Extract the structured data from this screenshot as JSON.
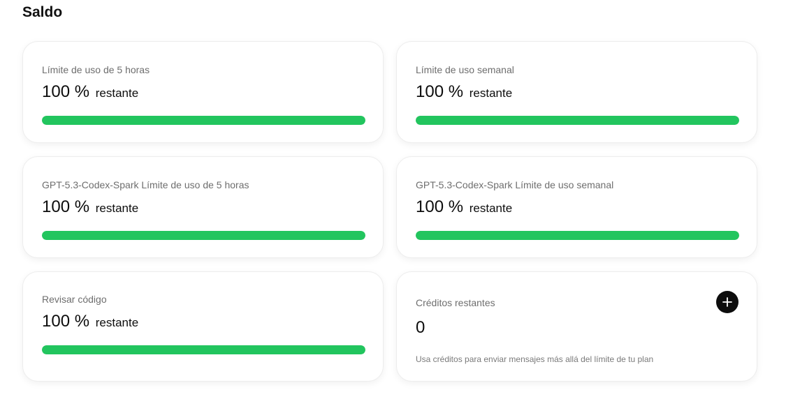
{
  "section": {
    "title": "Saldo"
  },
  "cards": [
    {
      "label": "Límite de uso de 5 horas",
      "value": "100 %",
      "suffix": "restante",
      "progress_percent": 100
    },
    {
      "label": "Límite de uso semanal",
      "value": "100 %",
      "suffix": "restante",
      "progress_percent": 100
    },
    {
      "label": "GPT-5.3-Codex-Spark Límite de uso de 5 horas",
      "value": "100 %",
      "suffix": "restante",
      "progress_percent": 100
    },
    {
      "label": "GPT-5.3-Codex-Spark Límite de uso semanal",
      "value": "100 %",
      "suffix": "restante",
      "progress_percent": 100
    },
    {
      "label": "Revisar código",
      "value": "100 %",
      "suffix": "restante",
      "progress_percent": 100
    }
  ],
  "credits": {
    "label": "Créditos restantes",
    "value": "0",
    "note": "Usa créditos para enviar mensajes más allá del límite de tu plan",
    "add_icon": "plus-icon"
  },
  "colors": {
    "progress_fill": "#22c55e",
    "progress_track": "#e6e6e6",
    "add_button_bg": "#0d0d0d"
  }
}
